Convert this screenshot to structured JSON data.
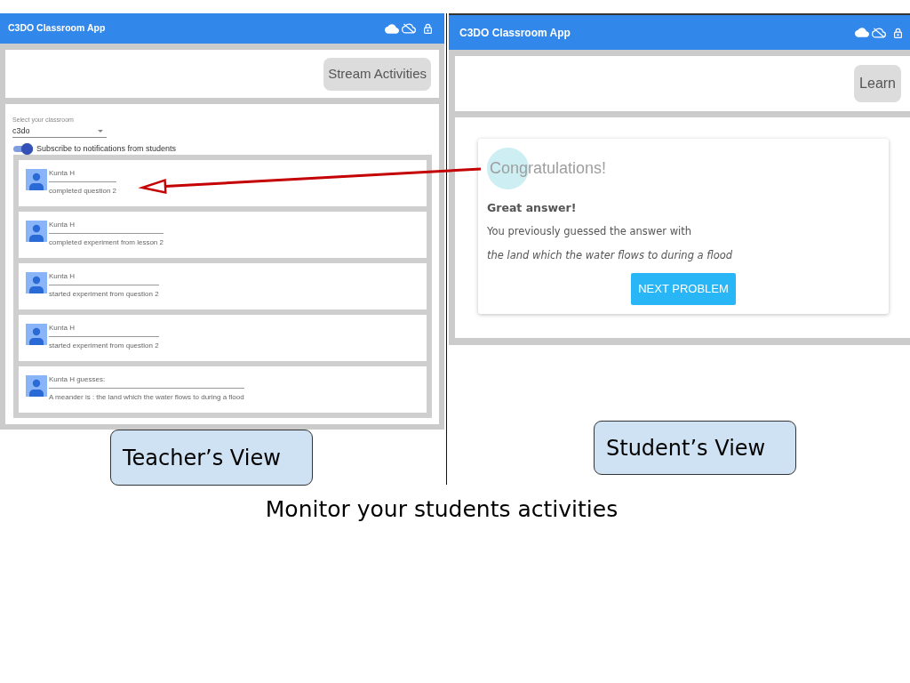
{
  "teacher_view": {
    "app_bar": {
      "title": "C3DO Classroom App"
    },
    "action_button": "Stream Activities",
    "classroom_select": {
      "label": "Select your classroom",
      "value": "c3do"
    },
    "subscribe_toggle": {
      "label": "Subscribe to notifications from students",
      "on": true
    },
    "activities": [
      {
        "name": "Kunta H",
        "text": "completed question 2"
      },
      {
        "name": "Kunta H",
        "text": "completed experiment from lesson 2"
      },
      {
        "name": "Kunta H",
        "text": "started experiment from question 2"
      },
      {
        "name": "Kunta H",
        "text": "started experiment from question 2"
      },
      {
        "name": "Kunta H guesses:",
        "text": "A meander is : the land which the water flows to during a flood"
      }
    ],
    "label": "Teacher’s View"
  },
  "student_view": {
    "app_bar": {
      "title": "C3DO Classroom App"
    },
    "action_button": "Learn",
    "result_card": {
      "heading": "Congratulations!",
      "subheading": "Great answer!",
      "message": "You previously guessed the answer with",
      "answer": "the land which the water flows to during a flood",
      "button": "NEXT PROBLEM"
    },
    "label": "Student’s View"
  },
  "caption": "Monitor your students activities"
}
